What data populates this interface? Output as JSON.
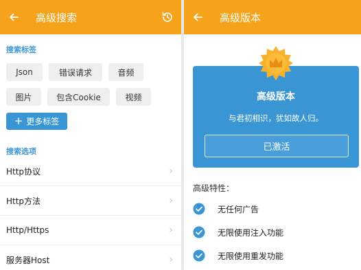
{
  "left": {
    "title": "高级搜索",
    "section_tags": "搜索标签",
    "tags": [
      "Json",
      "错误请求",
      "音频",
      "图片",
      "包含Cookie",
      "视频"
    ],
    "more_tags": "更多标签",
    "section_options": "搜索选项",
    "options": [
      "Http协议",
      "Http方法",
      "Http/Https",
      "服务器Host"
    ]
  },
  "right": {
    "title": "高级版本",
    "card_title": "高级版本",
    "card_subtitle": "与君初相识，犹如故人归。",
    "activated_button": "已激活",
    "features_title": "高级特性：",
    "features": [
      "无任何广告",
      "无限使用注入功能",
      "无限使用重发功能"
    ]
  },
  "colors": {
    "appbar": "#f7a21b",
    "accent_blue": "#3a95d5",
    "section_label": "#3f97d6"
  },
  "icons": [
    "back-arrow-icon",
    "history-icon",
    "chevron-right-icon",
    "crown-badge-icon",
    "check-circle-icon"
  ]
}
